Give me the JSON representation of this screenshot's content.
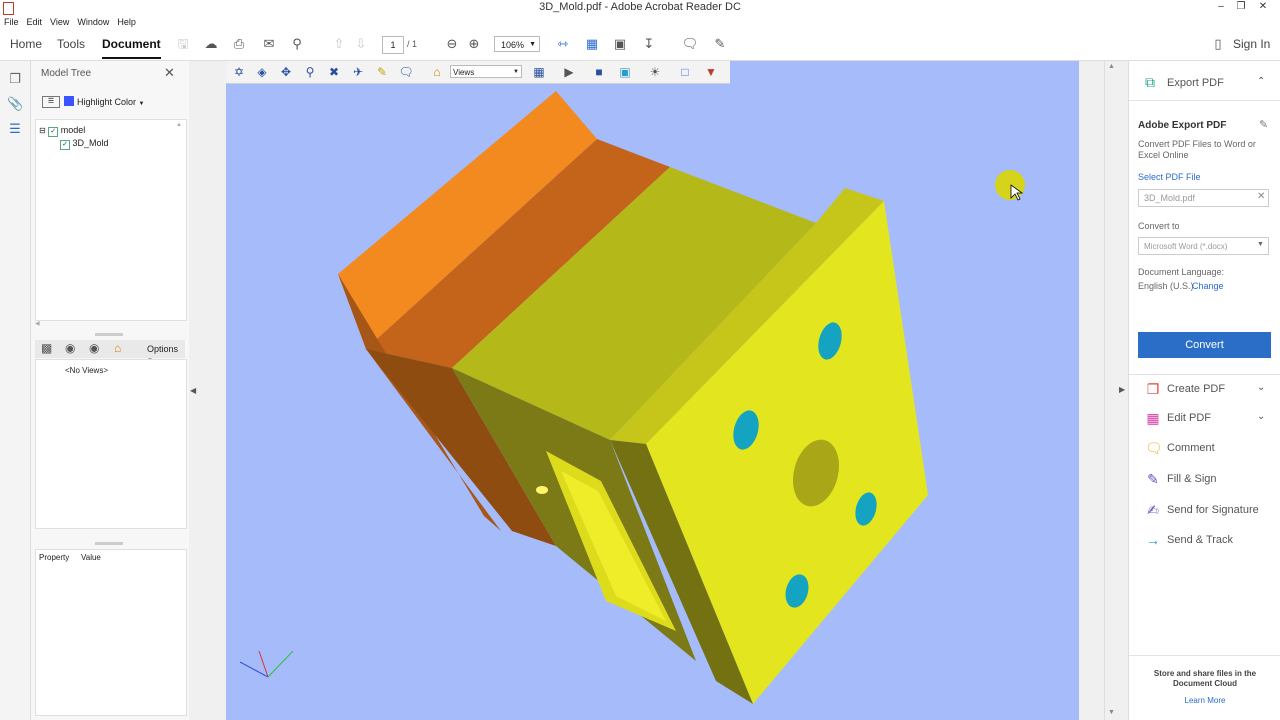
{
  "window": {
    "title": "3D_Mold.pdf - Adobe Acrobat Reader DC"
  },
  "menu": [
    "File",
    "Edit",
    "View",
    "Window",
    "Help"
  ],
  "toolbar": {
    "tabs": [
      "Home",
      "Tools",
      "Document"
    ],
    "active_tab": "Document",
    "page_current": "1",
    "page_total": "/ 1",
    "zoom": "106%",
    "sign_in": "Sign In"
  },
  "model_tree": {
    "title": "Model Tree",
    "highlight_label": "Highlight Color",
    "highlight_color": "#3a55ff",
    "nodes": [
      {
        "label": "model",
        "checked": true
      },
      {
        "label": "3D_Mold",
        "checked": true
      }
    ],
    "views_options": "Options",
    "no_views": "<No Views>",
    "property_headers": [
      "Property",
      "Value"
    ]
  },
  "viewer": {
    "views_select": "Views",
    "background_color": "#a5bbfa",
    "model_colors": {
      "top_plate": "#e87a1e",
      "body": "#d8d41b",
      "holes": "#11a3c2"
    }
  },
  "right_pane": {
    "export_title": "Export PDF",
    "adobe_export_heading": "Adobe Export PDF",
    "adobe_export_desc": "Convert PDF Files to Word or Excel Online",
    "select_file_label": "Select PDF File",
    "selected_file": "3D_Mold.pdf",
    "convert_to_label": "Convert to",
    "convert_to_value": "Microsoft Word (*.docx)",
    "doc_language_label": "Document Language:",
    "doc_language_value": "English (U.S.)",
    "change_link": "Change",
    "convert_button": "Convert",
    "tools": [
      {
        "label": "Create PDF",
        "icon": "create-pdf-icon",
        "color": "#e0443a",
        "expand": true
      },
      {
        "label": "Edit PDF",
        "icon": "edit-pdf-icon",
        "color": "#d63aa8",
        "expand": true
      },
      {
        "label": "Comment",
        "icon": "comment-icon",
        "color": "#f2b21c",
        "expand": false
      },
      {
        "label": "Fill & Sign",
        "icon": "fill-sign-icon",
        "color": "#6a4bc4",
        "expand": false
      },
      {
        "label": "Send for Signature",
        "icon": "send-signature-icon",
        "color": "#6a4bc4",
        "expand": false
      },
      {
        "label": "Send & Track",
        "icon": "send-track-icon",
        "color": "#2196c8",
        "expand": false
      }
    ],
    "cloud_text": "Store and share files in the Document Cloud",
    "learn_more": "Learn More"
  }
}
